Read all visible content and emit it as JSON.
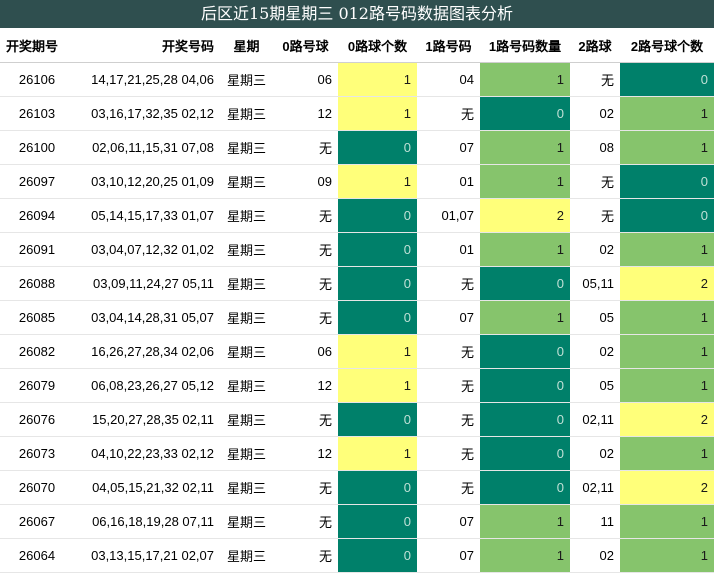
{
  "title": "后区近15期星期三 012路号码数据图表分析",
  "headers": [
    "开奖期号",
    "开奖号码",
    "星期",
    "0路号球",
    "0路球个数",
    "1路号码",
    "1路号码数量",
    "2路球",
    "2路号球个数"
  ],
  "colors": {
    "dark_green": "#00806a",
    "light_green": "#86c46c",
    "yellow": "#ffff7a",
    "title_bg": "#2f4f4f"
  },
  "rows": [
    {
      "period": "26106",
      "numbers": "14,17,21,25,28 04,06",
      "weekday": "星期三",
      "r0": "06",
      "c0": "1",
      "r1": "04",
      "c1": "1",
      "r2": "无",
      "c2": "0"
    },
    {
      "period": "26103",
      "numbers": "03,16,17,32,35 02,12",
      "weekday": "星期三",
      "r0": "12",
      "c0": "1",
      "r1": "无",
      "c1": "0",
      "r2": "02",
      "c2": "1"
    },
    {
      "period": "26100",
      "numbers": "02,06,11,15,31 07,08",
      "weekday": "星期三",
      "r0": "无",
      "c0": "0",
      "r1": "07",
      "c1": "1",
      "r2": "08",
      "c2": "1"
    },
    {
      "period": "26097",
      "numbers": "03,10,12,20,25 01,09",
      "weekday": "星期三",
      "r0": "09",
      "c0": "1",
      "r1": "01",
      "c1": "1",
      "r2": "无",
      "c2": "0"
    },
    {
      "period": "26094",
      "numbers": "05,14,15,17,33 01,07",
      "weekday": "星期三",
      "r0": "无",
      "c0": "0",
      "r1": "01,07",
      "c1": "2",
      "r2": "无",
      "c2": "0"
    },
    {
      "period": "26091",
      "numbers": "03,04,07,12,32 01,02",
      "weekday": "星期三",
      "r0": "无",
      "c0": "0",
      "r1": "01",
      "c1": "1",
      "r2": "02",
      "c2": "1"
    },
    {
      "period": "26088",
      "numbers": "03,09,11,24,27 05,11",
      "weekday": "星期三",
      "r0": "无",
      "c0": "0",
      "r1": "无",
      "c1": "0",
      "r2": "05,11",
      "c2": "2"
    },
    {
      "period": "26085",
      "numbers": "03,04,14,28,31 05,07",
      "weekday": "星期三",
      "r0": "无",
      "c0": "0",
      "r1": "07",
      "c1": "1",
      "r2": "05",
      "c2": "1"
    },
    {
      "period": "26082",
      "numbers": "16,26,27,28,34 02,06",
      "weekday": "星期三",
      "r0": "06",
      "c0": "1",
      "r1": "无",
      "c1": "0",
      "r2": "02",
      "c2": "1"
    },
    {
      "period": "26079",
      "numbers": "06,08,23,26,27 05,12",
      "weekday": "星期三",
      "r0": "12",
      "c0": "1",
      "r1": "无",
      "c1": "0",
      "r2": "05",
      "c2": "1"
    },
    {
      "period": "26076",
      "numbers": "15,20,27,28,35 02,11",
      "weekday": "星期三",
      "r0": "无",
      "c0": "0",
      "r1": "无",
      "c1": "0",
      "r2": "02,11",
      "c2": "2"
    },
    {
      "period": "26073",
      "numbers": "04,10,22,23,33 02,12",
      "weekday": "星期三",
      "r0": "12",
      "c0": "1",
      "r1": "无",
      "c1": "0",
      "r2": "02",
      "c2": "1"
    },
    {
      "period": "26070",
      "numbers": "04,05,15,21,32 02,11",
      "weekday": "星期三",
      "r0": "无",
      "c0": "0",
      "r1": "无",
      "c1": "0",
      "r2": "02,11",
      "c2": "2"
    },
    {
      "period": "26067",
      "numbers": "06,16,18,19,28 07,11",
      "weekday": "星期三",
      "r0": "无",
      "c0": "0",
      "r1": "07",
      "c1": "1",
      "r2": "11",
      "c2": "1"
    },
    {
      "period": "26064",
      "numbers": "03,13,15,17,21 02,07",
      "weekday": "星期三",
      "r0": "无",
      "c0": "0",
      "r1": "07",
      "c1": "1",
      "r2": "02",
      "c2": "1"
    }
  ]
}
